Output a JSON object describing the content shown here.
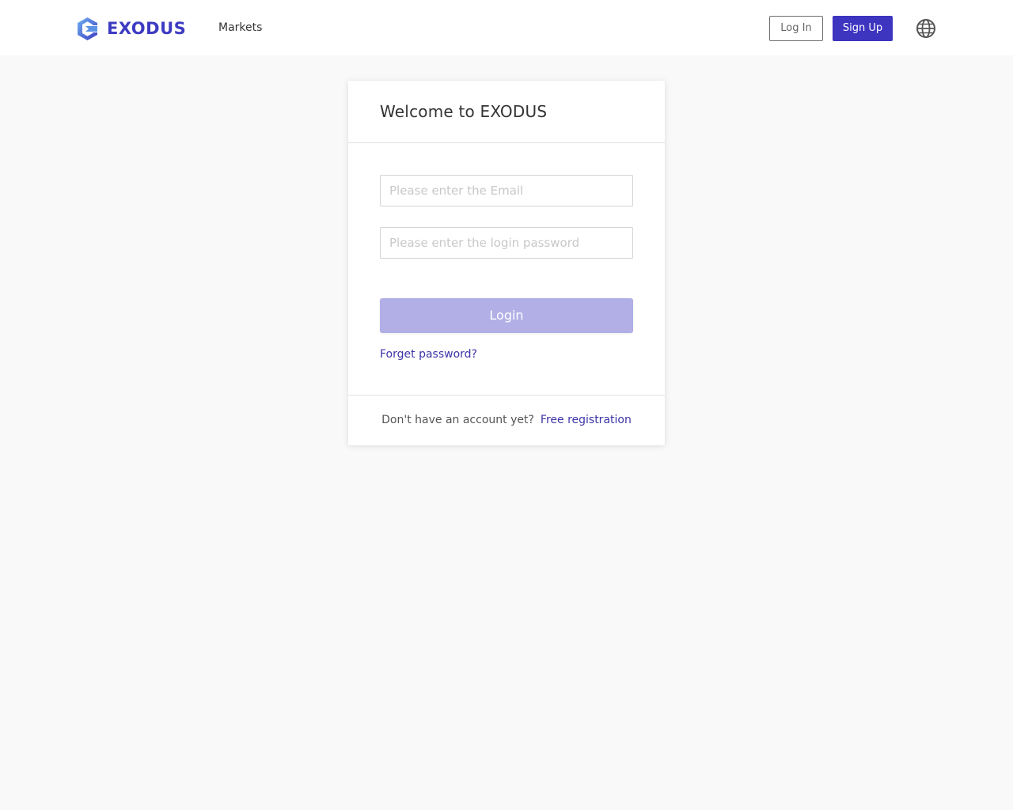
{
  "header": {
    "logo_text": "EXODUS",
    "nav_markets": "Markets",
    "login_label": "Log In",
    "signup_label": "Sign Up"
  },
  "login_card": {
    "title": "Welcome to EXODUS",
    "email_placeholder": "Please enter the Email",
    "password_placeholder": "Please enter the login password",
    "login_button": "Login",
    "forgot_link": "Forget password?",
    "footer_text": "Don't have an account yet?",
    "register_link": "Free registration"
  },
  "icons": {
    "logo": "exodus-logo-icon",
    "language": "globe-icon"
  },
  "colors": {
    "brand": "#3d34c0",
    "login_button_disabled": "#b1afe5",
    "link": "#3d34a8",
    "page_background": "#f9f9f9"
  }
}
